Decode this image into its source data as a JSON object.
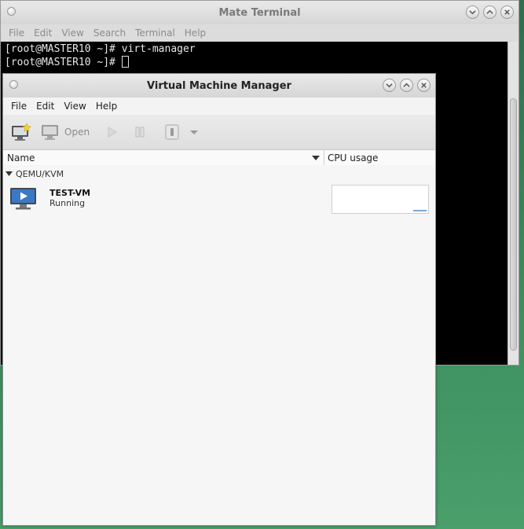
{
  "terminal": {
    "title": "Mate Terminal",
    "menu": [
      "File",
      "Edit",
      "View",
      "Search",
      "Terminal",
      "Help"
    ],
    "lines": [
      "[root@MASTER10 ~]# virt-manager",
      "[root@MASTER10 ~]# "
    ]
  },
  "vmm": {
    "title": "Virtual Machine Manager",
    "menu": [
      "File",
      "Edit",
      "View",
      "Help"
    ],
    "toolbar": {
      "open_label": "Open"
    },
    "columns": {
      "name": "Name",
      "cpu": "CPU usage"
    },
    "group": "QEMU/KVM",
    "vm": {
      "name": "TEST-VM",
      "status": "Running"
    }
  },
  "icons": {
    "window_menu": "window-menu-dot-icon",
    "minimize": "chevron-down-icon",
    "maximize": "chevron-up-icon",
    "close": "close-icon",
    "new_vm": "new-vm-icon",
    "open": "monitor-icon",
    "run": "play-icon",
    "pause": "pause-icon",
    "shutdown": "power-icon",
    "dropdown": "dropdown-arrow-icon",
    "vm": "vm-monitor-icon"
  },
  "colors": {
    "terminal_bg": "#000000",
    "accent": "#7fa6cf"
  }
}
